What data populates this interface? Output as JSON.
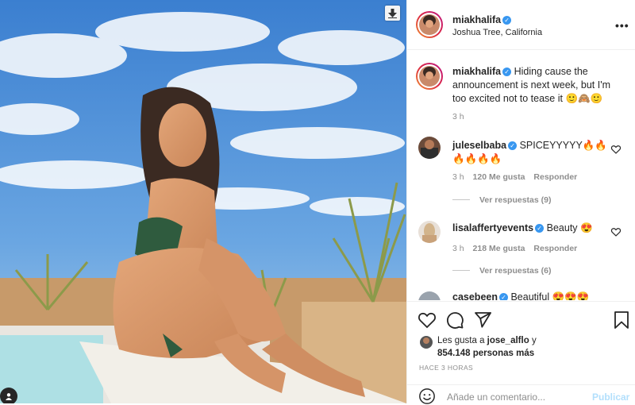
{
  "post": {
    "username": "miakhalifa",
    "verified": true,
    "location": "Joshua Tree, California",
    "more_icon": "more-horizontal-icon"
  },
  "caption": {
    "username": "miakhalifa",
    "text": "Hiding cause the announcement is next week, but I'm too excited not to tease it 🙂🙈🙂",
    "time": "3 h"
  },
  "comments": [
    {
      "username": "juleselbaba",
      "text": "SPICEYYYYY🔥🔥🔥🔥🔥🔥",
      "time": "3 h",
      "likes": "120 Me gusta",
      "reply": "Responder",
      "view_replies": "Ver respuestas (9)"
    },
    {
      "username": "lisalaffertyevents",
      "text": "Beauty 😍",
      "time": "3 h",
      "likes": "218 Me gusta",
      "reply": "Responder",
      "view_replies": "Ver respuestas (6)"
    },
    {
      "username": "casebeen",
      "text": "Beautiful 😍😍😍"
    }
  ],
  "actions": {
    "like_icon": "heart-icon",
    "comment_icon": "comment-icon",
    "share_icon": "share-icon",
    "save_icon": "bookmark-icon"
  },
  "likes": {
    "prefix": "Les gusta a",
    "user": "jose_alflo",
    "conj": "y",
    "count": "854.148 personas más"
  },
  "timestamp": "HACE 3 HORAS",
  "add_comment": {
    "placeholder": "Añade un comentario...",
    "publish": "Publicar"
  },
  "colors": {
    "verified": "#3897f0",
    "text": "#262626",
    "secondary": "#8e8e8e",
    "publish_disabled": "#b2dffc"
  }
}
